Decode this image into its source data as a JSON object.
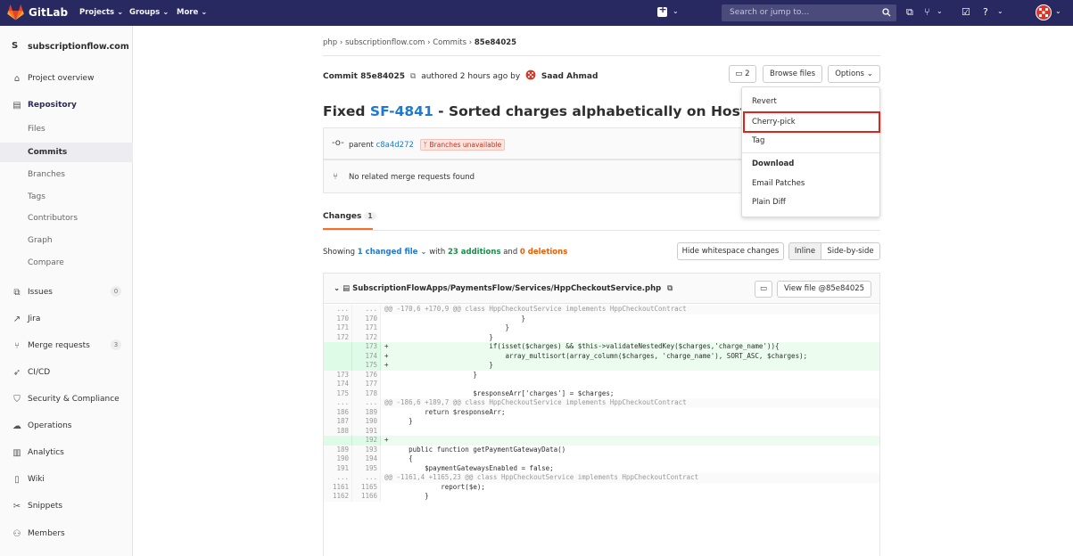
{
  "topbar": {
    "brand": "GitLab",
    "nav": [
      "Projects",
      "Groups",
      "More"
    ],
    "search_placeholder": "Search or jump to…"
  },
  "sidebar": {
    "project_initial": "S",
    "project_name": "subscriptionflow.com",
    "items": [
      {
        "label": "Project overview",
        "icon": "home-icon"
      },
      {
        "label": "Repository",
        "icon": "repository-icon"
      },
      {
        "label": "Files"
      },
      {
        "label": "Commits"
      },
      {
        "label": "Branches"
      },
      {
        "label": "Tags"
      },
      {
        "label": "Contributors"
      },
      {
        "label": "Graph"
      },
      {
        "label": "Compare"
      },
      {
        "label": "Issues",
        "icon": "issues-icon",
        "count": "0"
      },
      {
        "label": "Jira",
        "icon": "external-link-icon"
      },
      {
        "label": "Merge requests",
        "icon": "merge-request-icon",
        "count": "3"
      },
      {
        "label": "CI/CD",
        "icon": "rocket-icon"
      },
      {
        "label": "Security & Compliance",
        "icon": "shield-icon"
      },
      {
        "label": "Operations",
        "icon": "cloud-icon"
      },
      {
        "label": "Analytics",
        "icon": "chart-icon"
      },
      {
        "label": "Wiki",
        "icon": "book-icon"
      },
      {
        "label": "Snippets",
        "icon": "scissors-icon"
      },
      {
        "label": "Members",
        "icon": "users-icon"
      }
    ]
  },
  "breadcrumb": {
    "items": [
      "php",
      "subscriptionflow.com",
      "Commits"
    ],
    "current": "85e84025"
  },
  "commit": {
    "label": "Commit 85e84025",
    "authored": "authored 2 hours ago by",
    "author": "Saad Ahmad",
    "comments_count": "2",
    "browse_files": "Browse files",
    "options": "Options",
    "title_prefix": "Fixed ",
    "title_link": "SF-4841",
    "title_rest": " - Sorted charges alphabetically on Hosted Paym",
    "parent_label": "parent",
    "parent_sha": "c8a4d272",
    "branches_badge": "Branches unavailable",
    "merge_requests": "No related merge requests found"
  },
  "tabs": {
    "changes_label": "Changes",
    "changes_count": "1"
  },
  "summary": {
    "showing": "Showing",
    "changed_file": "1 changed file",
    "with": "with",
    "additions": "23 additions",
    "and": "and",
    "deletions": "0 deletions",
    "hide_whitespace": "Hide whitespace changes",
    "inline": "Inline",
    "side_by_side": "Side-by-side"
  },
  "file": {
    "path": "SubscriptionFlowApps/PaymentsFlow/Services/HppCheckoutService.php",
    "view_file": "View file @85e84025"
  },
  "dropdown": {
    "items": [
      "Revert",
      "Cherry-pick",
      "Tag"
    ],
    "header": "Download",
    "downloads": [
      "Email Patches",
      "Plain Diff"
    ]
  },
  "diff_lines": [
    {
      "type": "hunk",
      "o": "...",
      "n": "...",
      "code": "@@ -170,6 +170,9 @@ class HppCheckoutService implements HppCheckoutContract"
    },
    {
      "type": "ctx",
      "o": "170",
      "n": "170",
      "code": "                                  }"
    },
    {
      "type": "ctx",
      "o": "171",
      "n": "171",
      "code": "                              }"
    },
    {
      "type": "ctx",
      "o": "172",
      "n": "172",
      "code": "                          }"
    },
    {
      "type": "add",
      "o": "",
      "n": "173",
      "code": "+                         if(isset($charges) && $this->validateNestedKey($charges,'charge_name')){"
    },
    {
      "type": "add",
      "o": "",
      "n": "174",
      "code": "+                             array_multisort(array_column($charges, 'charge_name'), SORT_ASC, $charges);"
    },
    {
      "type": "add",
      "o": "",
      "n": "175",
      "code": "+                         }"
    },
    {
      "type": "ctx",
      "o": "173",
      "n": "176",
      "code": "                      }"
    },
    {
      "type": "ctx",
      "o": "174",
      "n": "177",
      "code": ""
    },
    {
      "type": "ctx",
      "o": "175",
      "n": "178",
      "code": "                      $responseArr['charges'] = $charges;"
    },
    {
      "type": "hunk",
      "o": "...",
      "n": "...",
      "code": "@@ -186,6 +189,7 @@ class HppCheckoutService implements HppCheckoutContract"
    },
    {
      "type": "ctx",
      "o": "186",
      "n": "189",
      "code": "          return $responseArr;"
    },
    {
      "type": "ctx",
      "o": "187",
      "n": "190",
      "code": "      }"
    },
    {
      "type": "ctx",
      "o": "188",
      "n": "191",
      "code": ""
    },
    {
      "type": "add",
      "o": "",
      "n": "192",
      "code": "+"
    },
    {
      "type": "ctx",
      "o": "189",
      "n": "193",
      "code": "      public function getPaymentGatewayData()"
    },
    {
      "type": "ctx",
      "o": "190",
      "n": "194",
      "code": "      {"
    },
    {
      "type": "ctx",
      "o": "191",
      "n": "195",
      "code": "          $paymentGatewaysEnabled = false;"
    },
    {
      "type": "hunk",
      "o": "...",
      "n": "...",
      "code": "@@ -1161,4 +1165,23 @@ class HppCheckoutService implements HppCheckoutContract"
    },
    {
      "type": "ctx",
      "o": "1161",
      "n": "1165",
      "code": "              report($e);"
    },
    {
      "type": "ctx",
      "o": "1162",
      "n": "1166",
      "code": "          }"
    }
  ]
}
